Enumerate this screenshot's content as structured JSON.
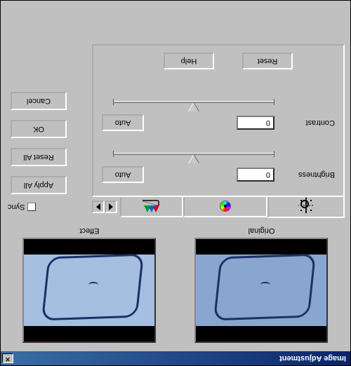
{
  "window": {
    "title": "Image Adjustment",
    "close_glyph": "×"
  },
  "previews": {
    "original_label": "Original",
    "effect_label": "Effect"
  },
  "tabs": {
    "brightness_contrast_icon": "sun-icon",
    "color_balance_icon": "wheel-icon",
    "curves_icon": "curves-icon",
    "sync_label": "Sync",
    "sync_checked": false
  },
  "controls": {
    "brightness": {
      "label": "Brightness",
      "value": "0",
      "auto_label": "Auto"
    },
    "contrast": {
      "label": "Contrast",
      "value": "0",
      "auto_label": "Auto"
    },
    "reset_label": "Reset",
    "help_label": "Help"
  },
  "buttons": {
    "apply_all": "Apply All",
    "reset_all": "Reset All",
    "ok": "OK",
    "cancel": "Cancel"
  }
}
